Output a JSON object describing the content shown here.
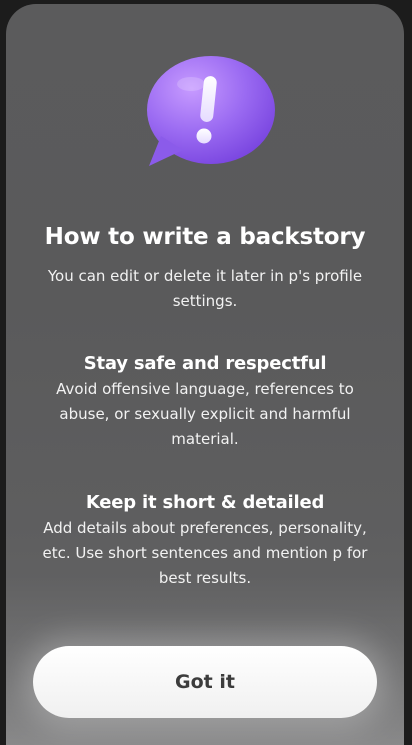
{
  "dialog": {
    "title": "How to write a backstory",
    "subtitle": "You can edit or delete it later in p's profile settings.",
    "sections": [
      {
        "heading": "Stay safe and respectful",
        "body": "Avoid offensive language, references to abuse, or sexually explicit and harmful material."
      },
      {
        "heading": "Keep it short & detailed",
        "body": "Add details about preferences, personality, etc. Use short sentences and mention p for best results."
      }
    ],
    "confirm_label": "Got it",
    "illustration_icon": "exclamation-speech-bubble-icon",
    "accent_color": "#9b6bf2"
  }
}
